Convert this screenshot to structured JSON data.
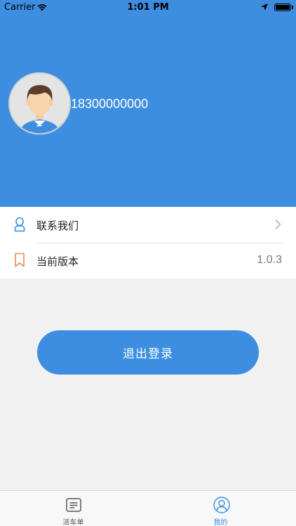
{
  "status_bar": {
    "carrier": "Carrier",
    "time": "1:01 PM"
  },
  "profile": {
    "phone": "18300000000"
  },
  "menu": {
    "contact_label": "联系我们",
    "version_label": "当前版本",
    "version_value": "1.0.3"
  },
  "logout_label": "退出登录",
  "tabbar": {
    "tabs": [
      {
        "label": "派车单",
        "icon": "document-list-icon",
        "active": false
      },
      {
        "label": "我的",
        "icon": "person-circle-icon",
        "active": true
      }
    ]
  },
  "colors": {
    "brand": "#3d8ee0",
    "background": "#f1f1f1",
    "bookmark": "#f0894a"
  }
}
